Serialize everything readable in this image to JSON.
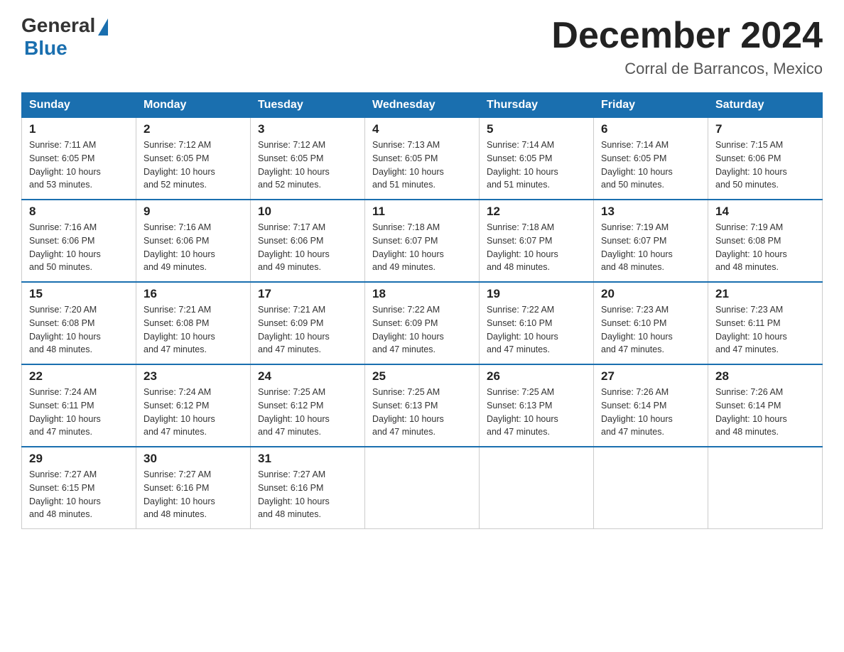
{
  "header": {
    "logo_general": "General",
    "logo_blue": "Blue",
    "month_title": "December 2024",
    "location": "Corral de Barrancos, Mexico"
  },
  "days_of_week": [
    "Sunday",
    "Monday",
    "Tuesday",
    "Wednesday",
    "Thursday",
    "Friday",
    "Saturday"
  ],
  "weeks": [
    [
      {
        "day": "1",
        "sunrise": "7:11 AM",
        "sunset": "6:05 PM",
        "daylight": "10 hours and 53 minutes."
      },
      {
        "day": "2",
        "sunrise": "7:12 AM",
        "sunset": "6:05 PM",
        "daylight": "10 hours and 52 minutes."
      },
      {
        "day": "3",
        "sunrise": "7:12 AM",
        "sunset": "6:05 PM",
        "daylight": "10 hours and 52 minutes."
      },
      {
        "day": "4",
        "sunrise": "7:13 AM",
        "sunset": "6:05 PM",
        "daylight": "10 hours and 51 minutes."
      },
      {
        "day": "5",
        "sunrise": "7:14 AM",
        "sunset": "6:05 PM",
        "daylight": "10 hours and 51 minutes."
      },
      {
        "day": "6",
        "sunrise": "7:14 AM",
        "sunset": "6:05 PM",
        "daylight": "10 hours and 50 minutes."
      },
      {
        "day": "7",
        "sunrise": "7:15 AM",
        "sunset": "6:06 PM",
        "daylight": "10 hours and 50 minutes."
      }
    ],
    [
      {
        "day": "8",
        "sunrise": "7:16 AM",
        "sunset": "6:06 PM",
        "daylight": "10 hours and 50 minutes."
      },
      {
        "day": "9",
        "sunrise": "7:16 AM",
        "sunset": "6:06 PM",
        "daylight": "10 hours and 49 minutes."
      },
      {
        "day": "10",
        "sunrise": "7:17 AM",
        "sunset": "6:06 PM",
        "daylight": "10 hours and 49 minutes."
      },
      {
        "day": "11",
        "sunrise": "7:18 AM",
        "sunset": "6:07 PM",
        "daylight": "10 hours and 49 minutes."
      },
      {
        "day": "12",
        "sunrise": "7:18 AM",
        "sunset": "6:07 PM",
        "daylight": "10 hours and 48 minutes."
      },
      {
        "day": "13",
        "sunrise": "7:19 AM",
        "sunset": "6:07 PM",
        "daylight": "10 hours and 48 minutes."
      },
      {
        "day": "14",
        "sunrise": "7:19 AM",
        "sunset": "6:08 PM",
        "daylight": "10 hours and 48 minutes."
      }
    ],
    [
      {
        "day": "15",
        "sunrise": "7:20 AM",
        "sunset": "6:08 PM",
        "daylight": "10 hours and 48 minutes."
      },
      {
        "day": "16",
        "sunrise": "7:21 AM",
        "sunset": "6:08 PM",
        "daylight": "10 hours and 47 minutes."
      },
      {
        "day": "17",
        "sunrise": "7:21 AM",
        "sunset": "6:09 PM",
        "daylight": "10 hours and 47 minutes."
      },
      {
        "day": "18",
        "sunrise": "7:22 AM",
        "sunset": "6:09 PM",
        "daylight": "10 hours and 47 minutes."
      },
      {
        "day": "19",
        "sunrise": "7:22 AM",
        "sunset": "6:10 PM",
        "daylight": "10 hours and 47 minutes."
      },
      {
        "day": "20",
        "sunrise": "7:23 AM",
        "sunset": "6:10 PM",
        "daylight": "10 hours and 47 minutes."
      },
      {
        "day": "21",
        "sunrise": "7:23 AM",
        "sunset": "6:11 PM",
        "daylight": "10 hours and 47 minutes."
      }
    ],
    [
      {
        "day": "22",
        "sunrise": "7:24 AM",
        "sunset": "6:11 PM",
        "daylight": "10 hours and 47 minutes."
      },
      {
        "day": "23",
        "sunrise": "7:24 AM",
        "sunset": "6:12 PM",
        "daylight": "10 hours and 47 minutes."
      },
      {
        "day": "24",
        "sunrise": "7:25 AM",
        "sunset": "6:12 PM",
        "daylight": "10 hours and 47 minutes."
      },
      {
        "day": "25",
        "sunrise": "7:25 AM",
        "sunset": "6:13 PM",
        "daylight": "10 hours and 47 minutes."
      },
      {
        "day": "26",
        "sunrise": "7:25 AM",
        "sunset": "6:13 PM",
        "daylight": "10 hours and 47 minutes."
      },
      {
        "day": "27",
        "sunrise": "7:26 AM",
        "sunset": "6:14 PM",
        "daylight": "10 hours and 47 minutes."
      },
      {
        "day": "28",
        "sunrise": "7:26 AM",
        "sunset": "6:14 PM",
        "daylight": "10 hours and 48 minutes."
      }
    ],
    [
      {
        "day": "29",
        "sunrise": "7:27 AM",
        "sunset": "6:15 PM",
        "daylight": "10 hours and 48 minutes."
      },
      {
        "day": "30",
        "sunrise": "7:27 AM",
        "sunset": "6:16 PM",
        "daylight": "10 hours and 48 minutes."
      },
      {
        "day": "31",
        "sunrise": "7:27 AM",
        "sunset": "6:16 PM",
        "daylight": "10 hours and 48 minutes."
      },
      null,
      null,
      null,
      null
    ]
  ],
  "labels": {
    "sunrise": "Sunrise:",
    "sunset": "Sunset:",
    "daylight": "Daylight:"
  }
}
